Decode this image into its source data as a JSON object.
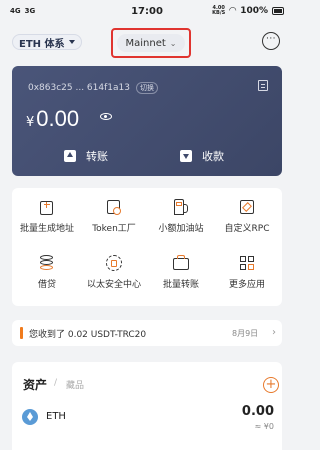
{
  "status_bar": {
    "signals": [
      "4G",
      "3G"
    ],
    "time": "17:00",
    "speed_top": "4.00",
    "speed_bottom": "KB/S",
    "battery": "100%"
  },
  "header": {
    "chain": "ETH 体系",
    "network": "Mainnet"
  },
  "wallet_card": {
    "address": "0x863c25 ... 614f1a13",
    "switch_label": "切换",
    "currency_symbol": "¥",
    "balance": "0.00",
    "transfer_label": "转账",
    "receive_label": "收款",
    "card_color": "#45507a"
  },
  "tools": [
    {
      "label": "批量生成地址",
      "icon": "batch-address-icon"
    },
    {
      "label": "Token工厂",
      "icon": "token-factory-icon"
    },
    {
      "label": "小额加油站",
      "icon": "gas-station-icon"
    },
    {
      "label": "自定义RPC",
      "icon": "custom-rpc-icon"
    },
    {
      "label": "借贷",
      "icon": "lending-icon"
    },
    {
      "label": "以太安全中心",
      "icon": "security-center-icon"
    },
    {
      "label": "批量转账",
      "icon": "batch-transfer-icon"
    },
    {
      "label": "更多应用",
      "icon": "more-apps-icon"
    }
  ],
  "notice": {
    "text": "您收到了 0.02  USDT-TRC20",
    "date": "8月9日",
    "accent_color": "#f07b1d"
  },
  "assets": {
    "tab_assets": "资产",
    "tab_separator": "/",
    "tab_collectibles": "藏品",
    "tokens": [
      {
        "symbol": "ETH",
        "amount": "0.00",
        "value": "≈ ¥0"
      }
    ]
  },
  "accent_color": "#e77a2d"
}
